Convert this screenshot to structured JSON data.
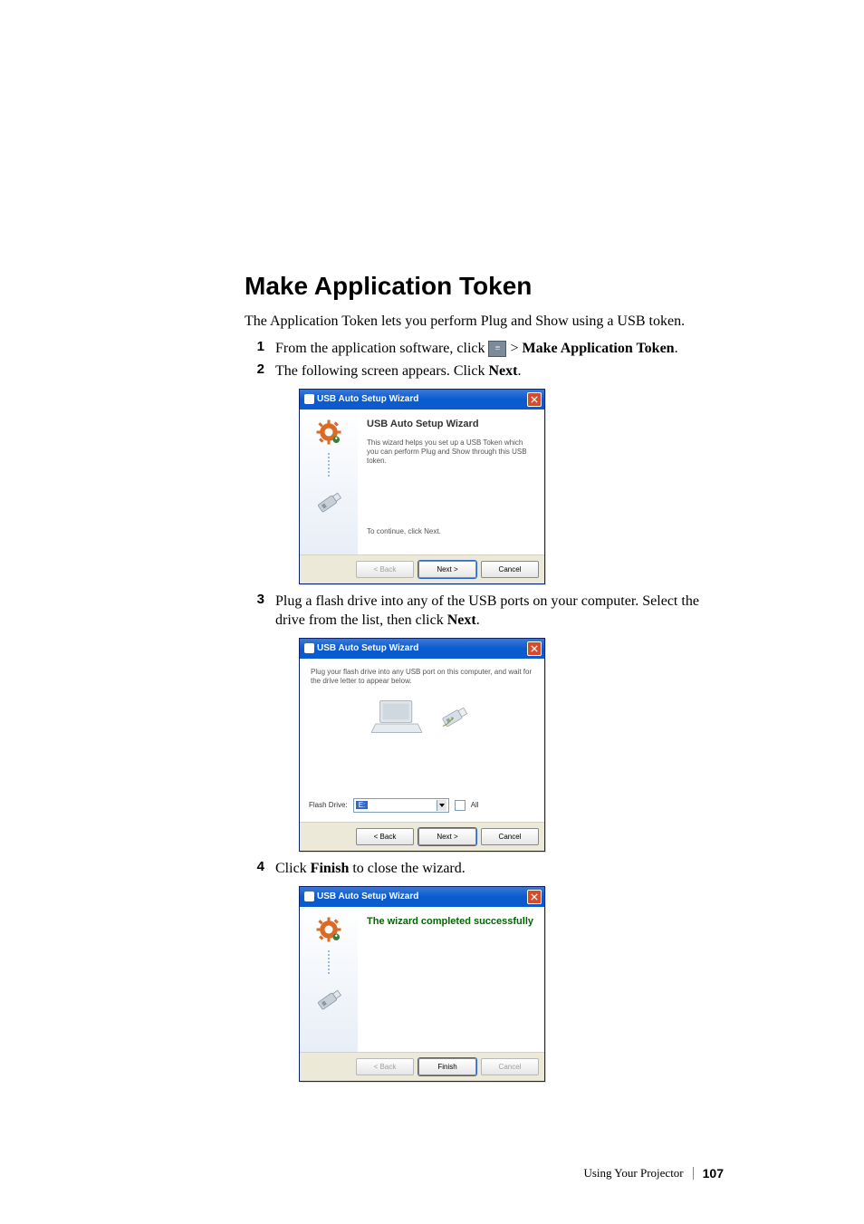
{
  "heading": "Make Application Token",
  "intro": "The Application Token lets you perform Plug and Show using a USB token.",
  "steps": {
    "s1": {
      "num": "1",
      "prefix": "From the application software, click ",
      "after_icon": " > ",
      "bold": "Make Application Token",
      "suffix": "."
    },
    "s2": {
      "num": "2",
      "prefix": "The following screen appears. Click ",
      "bold": "Next",
      "suffix": "."
    },
    "s3": {
      "num": "3",
      "prefix": "Plug a flash drive into any of the USB ports on your computer. Select the drive from the list, then click ",
      "bold": "Next",
      "suffix": "."
    },
    "s4": {
      "num": "4",
      "prefix": "Click ",
      "bold": "Finish",
      "suffix": " to close the wizard."
    }
  },
  "dialog": {
    "title": "USB Auto Setup Wizard",
    "wizard_heading": "USB Auto Setup Wizard",
    "wizard_desc": "This wizard helps you set up a USB Token which you can perform Plug and Show through this USB token.",
    "wizard_continue": "To continue, click Next.",
    "plug_text": "Plug your flash drive into any USB port on this computer, and wait for the drive letter to appear below.",
    "flash_label": "Flash Drive:",
    "flash_value": "E:",
    "all_label": "All",
    "complete_heading": "The wizard completed successfully",
    "buttons": {
      "back": "< Back",
      "next": "Next >",
      "cancel": "Cancel",
      "finish": "Finish"
    }
  },
  "footer": {
    "section": "Using Your Projector",
    "page": "107"
  }
}
